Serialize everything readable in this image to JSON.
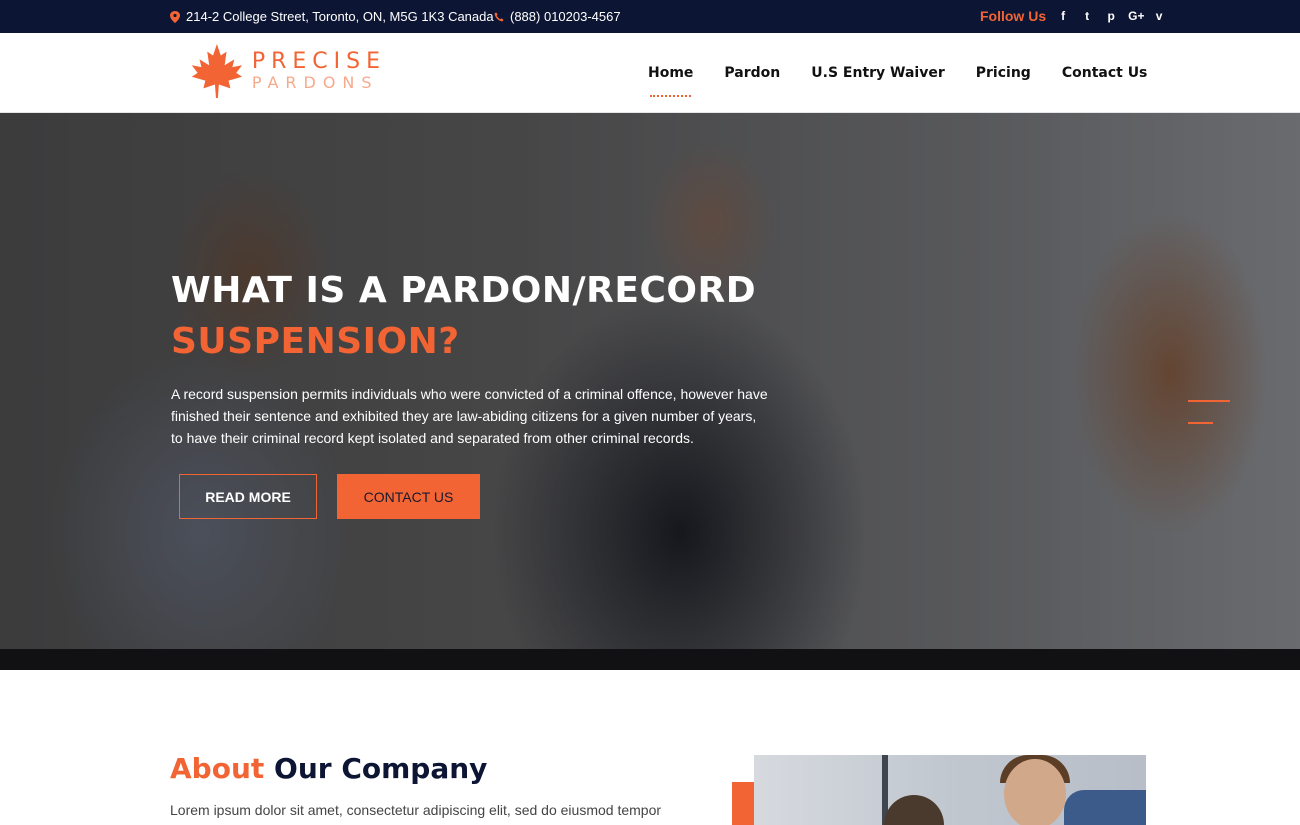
{
  "topbar": {
    "address": "214-2 College Street, Toronto, ON, M5G 1K3 Canada",
    "phone": "(888) 010203-4567",
    "follow_label": "Follow Us",
    "social": [
      {
        "icon": "facebook-icon",
        "glyph": "f"
      },
      {
        "icon": "twitter-icon",
        "glyph": "t"
      },
      {
        "icon": "pinterest-icon",
        "glyph": "p"
      },
      {
        "icon": "google-plus-icon",
        "glyph": "G+"
      },
      {
        "icon": "vimeo-icon",
        "glyph": "v"
      }
    ]
  },
  "brand": {
    "line1": "PRECISE",
    "line2": "PARDONS",
    "icon": "maple-leaf-icon"
  },
  "nav": {
    "items": [
      {
        "label": "Home",
        "active": true
      },
      {
        "label": "Pardon",
        "active": false
      },
      {
        "label": "U.S Entry Waiver",
        "active": false
      },
      {
        "label": "Pricing",
        "active": false
      },
      {
        "label": "Contact Us",
        "active": false
      }
    ]
  },
  "hero": {
    "title_line1": "WHAT IS A PARDON/RECORD",
    "title_line2": "SUSPENSION?",
    "body": "A record suspension permits individuals who were convicted of a criminal offence, however have finished their sentence and exhibited they are law-abiding citizens for a given number of years, to have their criminal record kept isolated and separated from other criminal records.",
    "read_more_label": "READ MORE",
    "contact_label": "CONTACT US"
  },
  "about": {
    "title_accent": "About",
    "title_rest": "Our Company",
    "text": "Lorem ipsum dolor sit amet, consectetur adipiscing elit, sed do eiusmod tempor"
  },
  "colors": {
    "accent": "#f26434",
    "navy": "#0c1533",
    "white": "#ffffff"
  }
}
